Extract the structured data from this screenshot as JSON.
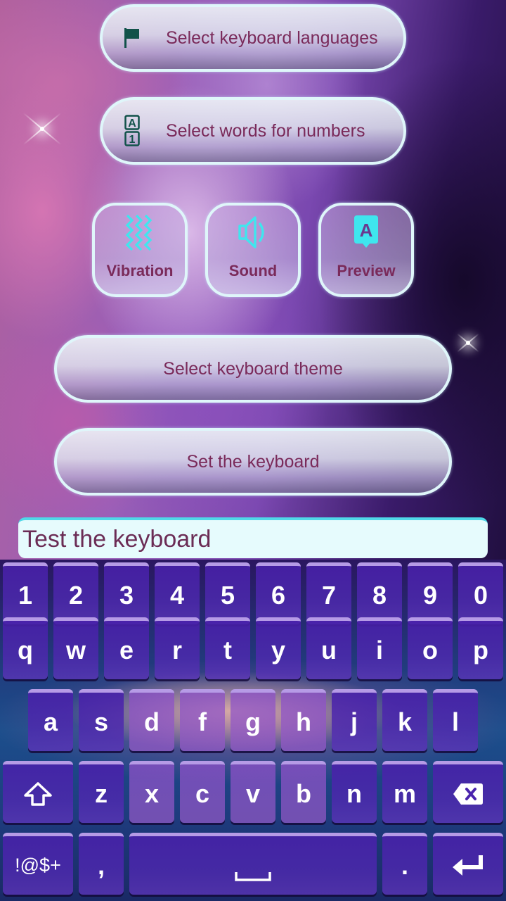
{
  "settings": {
    "languages_label": "Select keyboard languages",
    "numbers_label": "Select words for numbers",
    "toggles": [
      {
        "label": "Vibration",
        "icon": "vibration-icon"
      },
      {
        "label": "Sound",
        "icon": "speaker-icon"
      },
      {
        "label": "Preview",
        "icon": "key-preview-icon"
      }
    ],
    "theme_label": "Select keyboard theme",
    "set_keyboard_label": "Set the keyboard"
  },
  "test_field": {
    "value": "Test the keyboard"
  },
  "colors": {
    "label_text": "#7a2a5a",
    "icon_accent": "#3fe6ee",
    "icon_dark": "#12524a",
    "key_face": "#4a24ad",
    "key_highlight": "#b69be6"
  },
  "keyboard": {
    "row_numbers": [
      "1",
      "2",
      "3",
      "4",
      "5",
      "6",
      "7",
      "8",
      "9",
      "0"
    ],
    "row_top": [
      "q",
      "w",
      "e",
      "r",
      "t",
      "y",
      "u",
      "i",
      "o",
      "p"
    ],
    "row_home": [
      "a",
      "s",
      "d",
      "f",
      "g",
      "h",
      "j",
      "k",
      "l"
    ],
    "row_bottom_letters": [
      "z",
      "x",
      "c",
      "v",
      "b",
      "n",
      "m"
    ],
    "shift_icon": "shift-arrow-icon",
    "backspace_icon": "backspace-icon",
    "symbols_label": "!@$+",
    "comma_label": ",",
    "space_icon": "space-bar-icon",
    "period_label": ".",
    "enter_icon": "enter-return-icon"
  }
}
